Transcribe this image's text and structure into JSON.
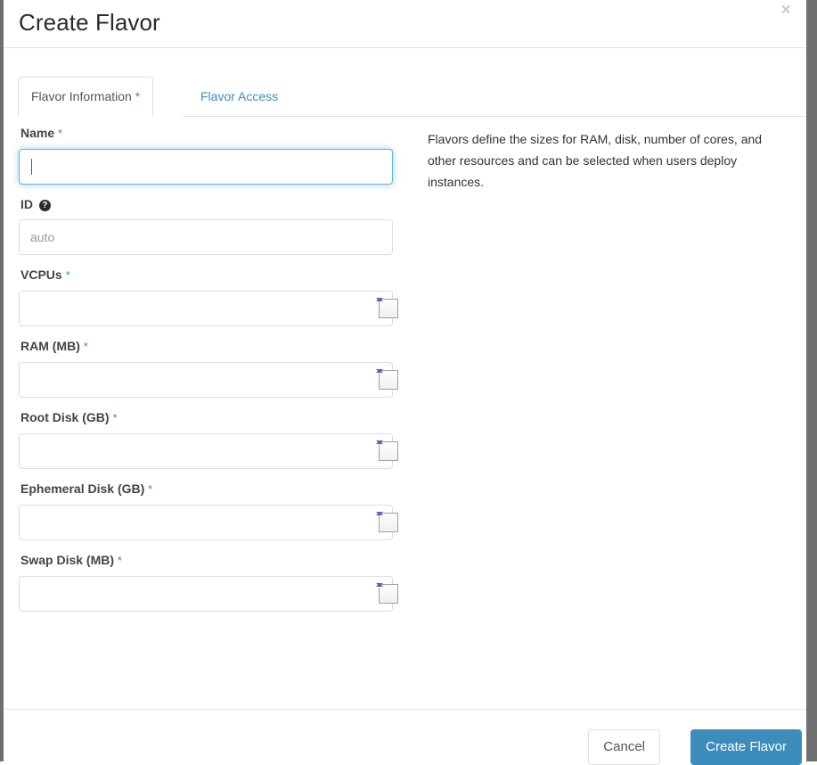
{
  "modal": {
    "title": "Create Flavor",
    "close_label": "×",
    "close_icon": "close-icon"
  },
  "tabs": [
    {
      "label": "Flavor Information",
      "required_marker": "*",
      "active": true
    },
    {
      "label": "Flavor Access",
      "required_marker": "",
      "active": false
    }
  ],
  "help": {
    "description": "Flavors define the sizes for RAM, disk, number of cores, and other resources and can be selected when users deploy instances."
  },
  "form": {
    "required_marker": "*",
    "help_icon_glyph": "?",
    "fields": [
      {
        "label": "Name",
        "required_marker": "*",
        "type": "text",
        "value": "",
        "placeholder": "",
        "focused": true,
        "has_help_icon": false
      },
      {
        "label": "ID",
        "required_marker": "",
        "type": "text",
        "value": "",
        "placeholder": "auto",
        "focused": false,
        "has_help_icon": true
      },
      {
        "label": "VCPUs",
        "required_marker": "*",
        "type": "number",
        "value": "",
        "placeholder": "",
        "focused": false,
        "has_help_icon": false
      },
      {
        "label": "RAM (MB)",
        "required_marker": "*",
        "type": "number",
        "value": "",
        "placeholder": "",
        "focused": false,
        "has_help_icon": false
      },
      {
        "label": "Root Disk (GB)",
        "required_marker": "*",
        "type": "number",
        "value": "",
        "placeholder": "",
        "focused": false,
        "has_help_icon": false
      },
      {
        "label": "Ephemeral Disk (GB)",
        "required_marker": "*",
        "type": "number",
        "value": "",
        "placeholder": "",
        "focused": false,
        "has_help_icon": false
      },
      {
        "label": "Swap Disk (MB)",
        "required_marker": "*",
        "type": "number",
        "value": "",
        "placeholder": "",
        "focused": false,
        "has_help_icon": false
      }
    ]
  },
  "footer": {
    "cancel_label": "Cancel",
    "submit_label": "Create Flavor"
  },
  "colors": {
    "accent_blue": "#3c8dbc",
    "link_blue": "#3c8dbc",
    "focus_blue": "#66afe9",
    "spinner_arrow": "#5566b3",
    "label_text": "#444444",
    "border_gray": "#dddddd",
    "backdrop_gray": "#6f6f6f"
  }
}
